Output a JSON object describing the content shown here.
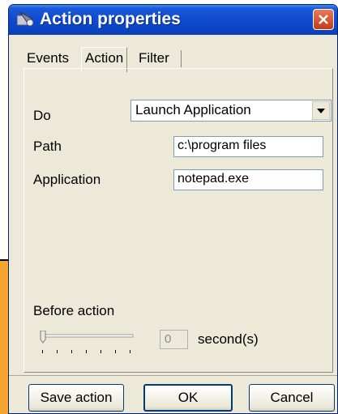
{
  "window": {
    "title": "Action properties"
  },
  "tabs": [
    {
      "label": "Events"
    },
    {
      "label": "Action"
    },
    {
      "label": "Filter"
    }
  ],
  "form": {
    "do": {
      "label": "Do",
      "value": "Launch Application"
    },
    "path": {
      "label": "Path",
      "value": "c:\\program files"
    },
    "application": {
      "label": "Application",
      "value": "notepad.exe"
    },
    "before_action": {
      "label": "Before action",
      "seconds_value": "0",
      "unit": "second(s)",
      "slider_level": 0
    }
  },
  "buttons": {
    "save_action": "Save action",
    "ok": "OK",
    "cancel": "Cancel"
  },
  "colors": {
    "accent_panel": "#f7a531",
    "titlebar": "#0f4ccf",
    "close": "#c43b1a"
  }
}
